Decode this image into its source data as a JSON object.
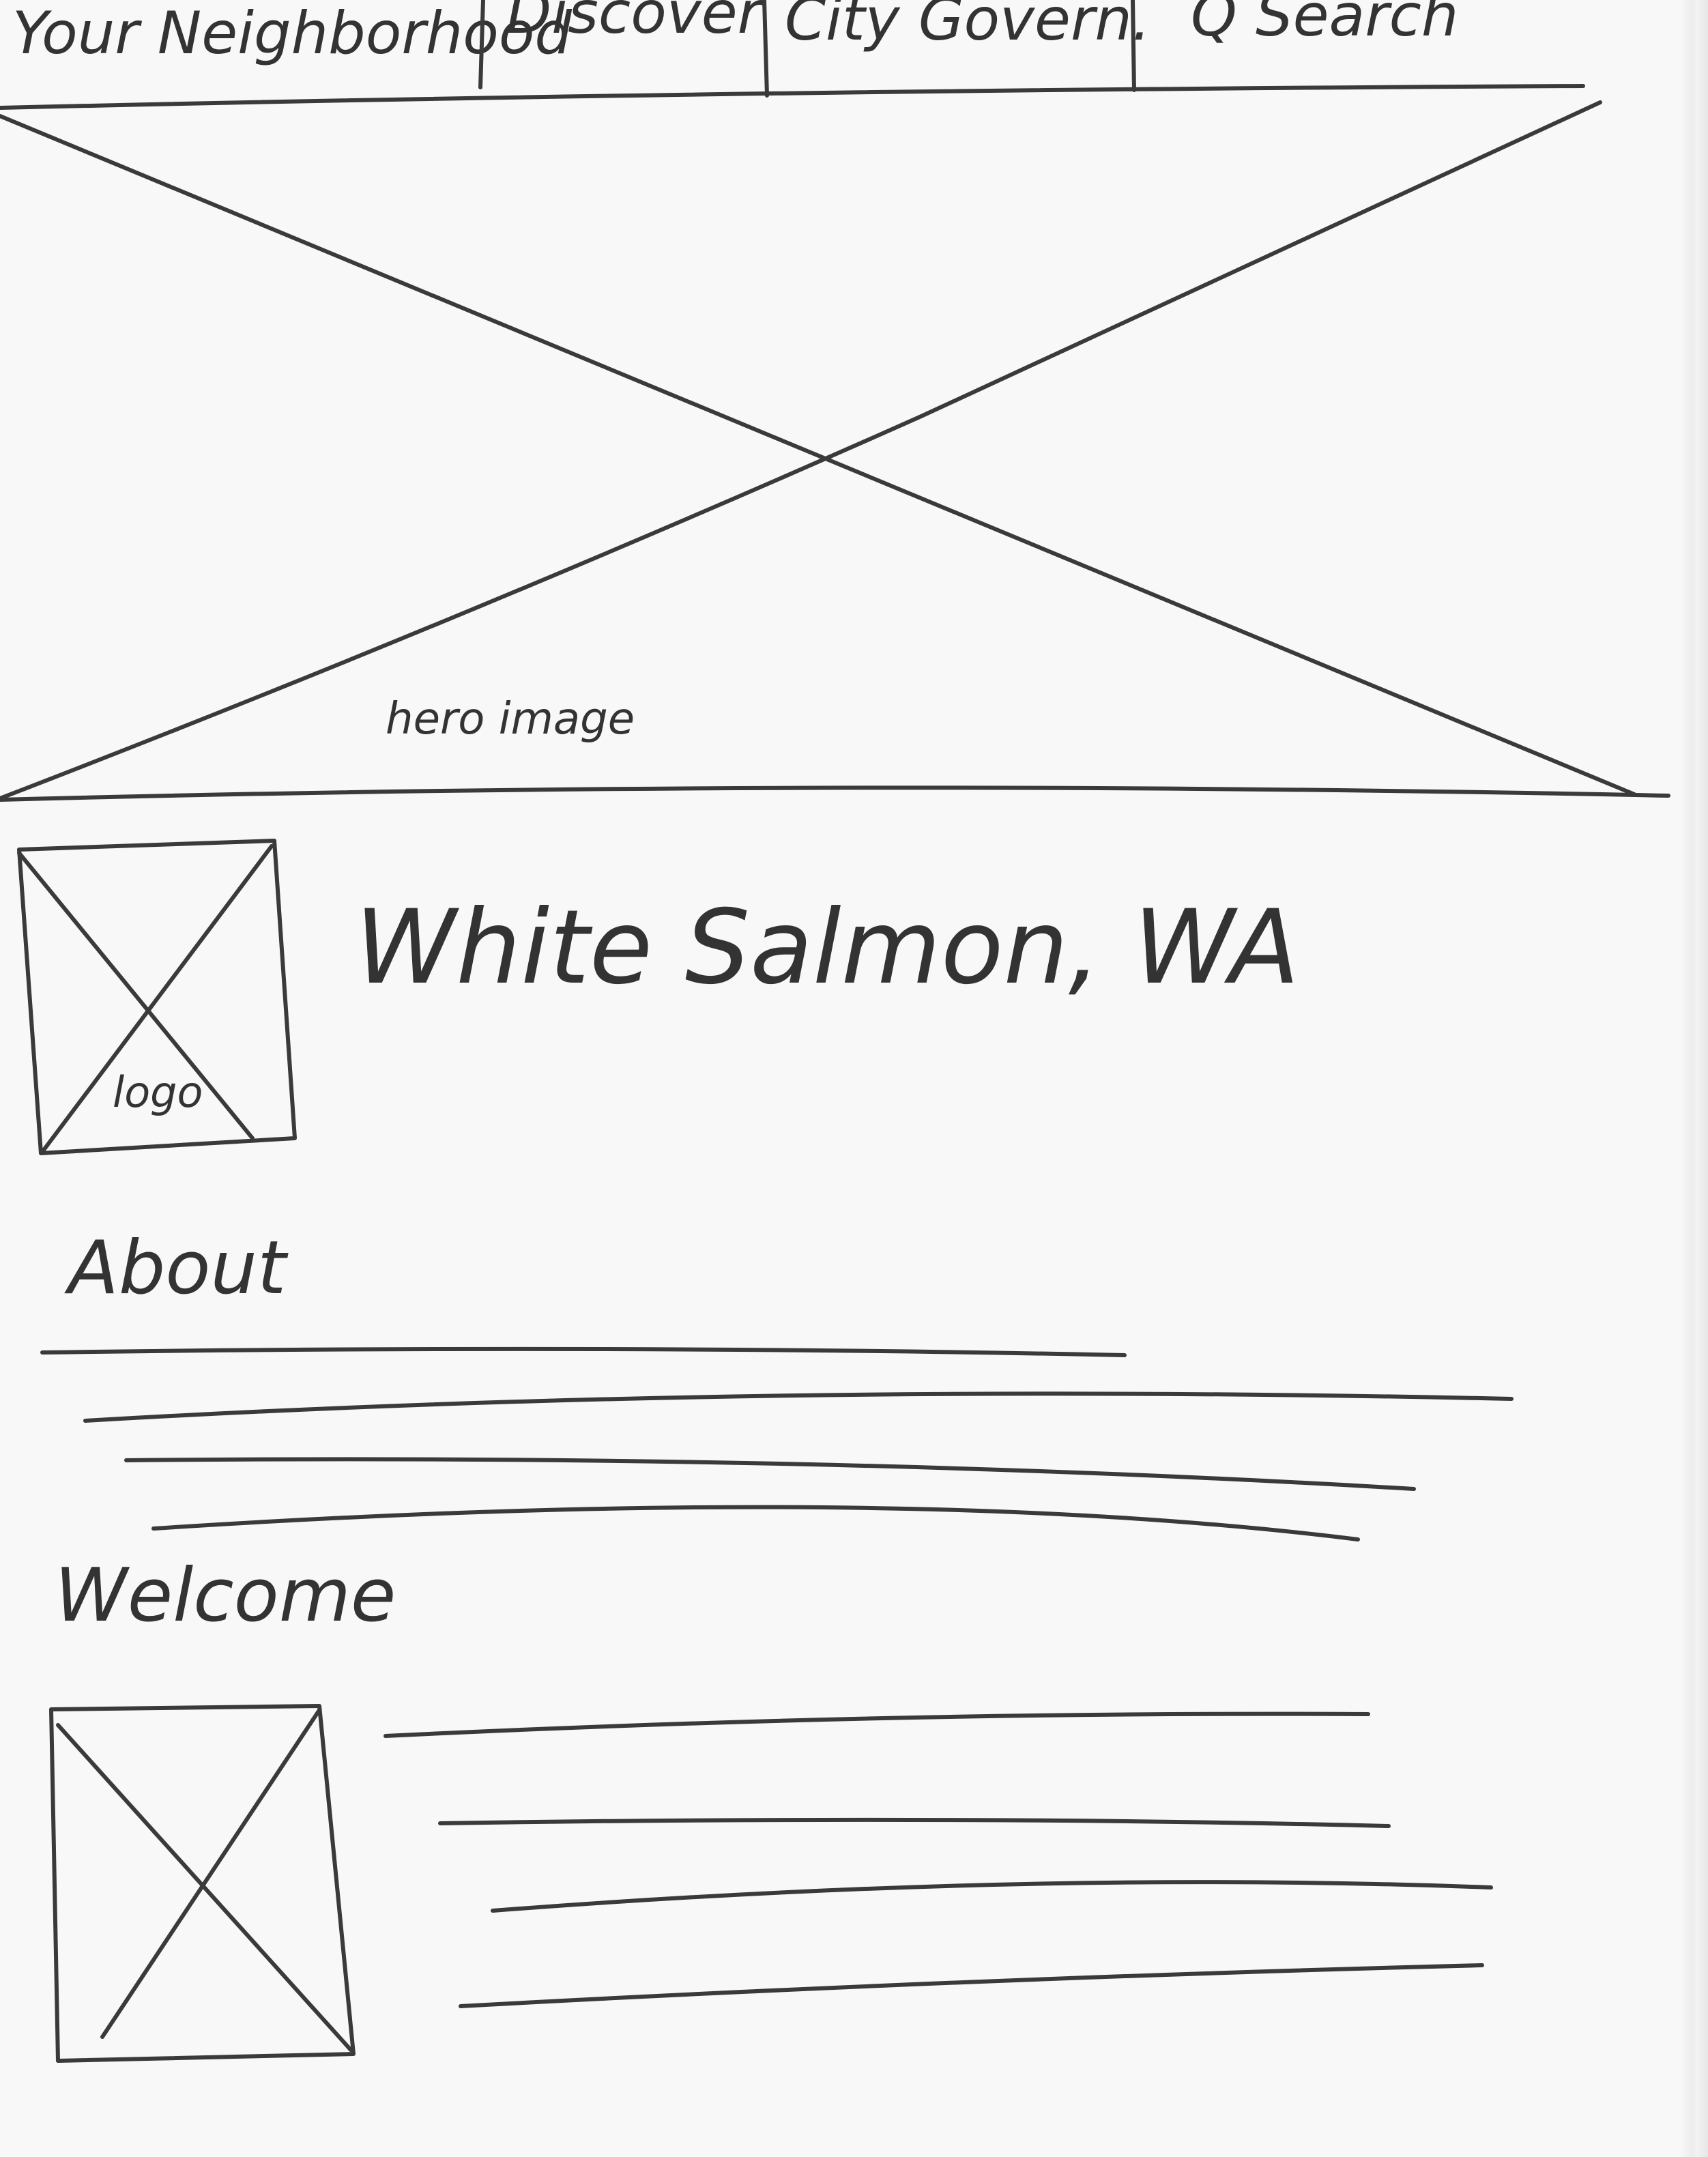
{
  "nav": {
    "items": [
      {
        "label": "Your Neighborhood"
      },
      {
        "label": "Discover"
      },
      {
        "label": "City Govern."
      },
      {
        "label": "Q Search"
      }
    ]
  },
  "hero": {
    "caption": "hero image"
  },
  "site": {
    "title": "White Salmon, WA",
    "logo_label": "logo"
  },
  "sections": {
    "about_heading": "About",
    "welcome_heading": "Welcome"
  }
}
